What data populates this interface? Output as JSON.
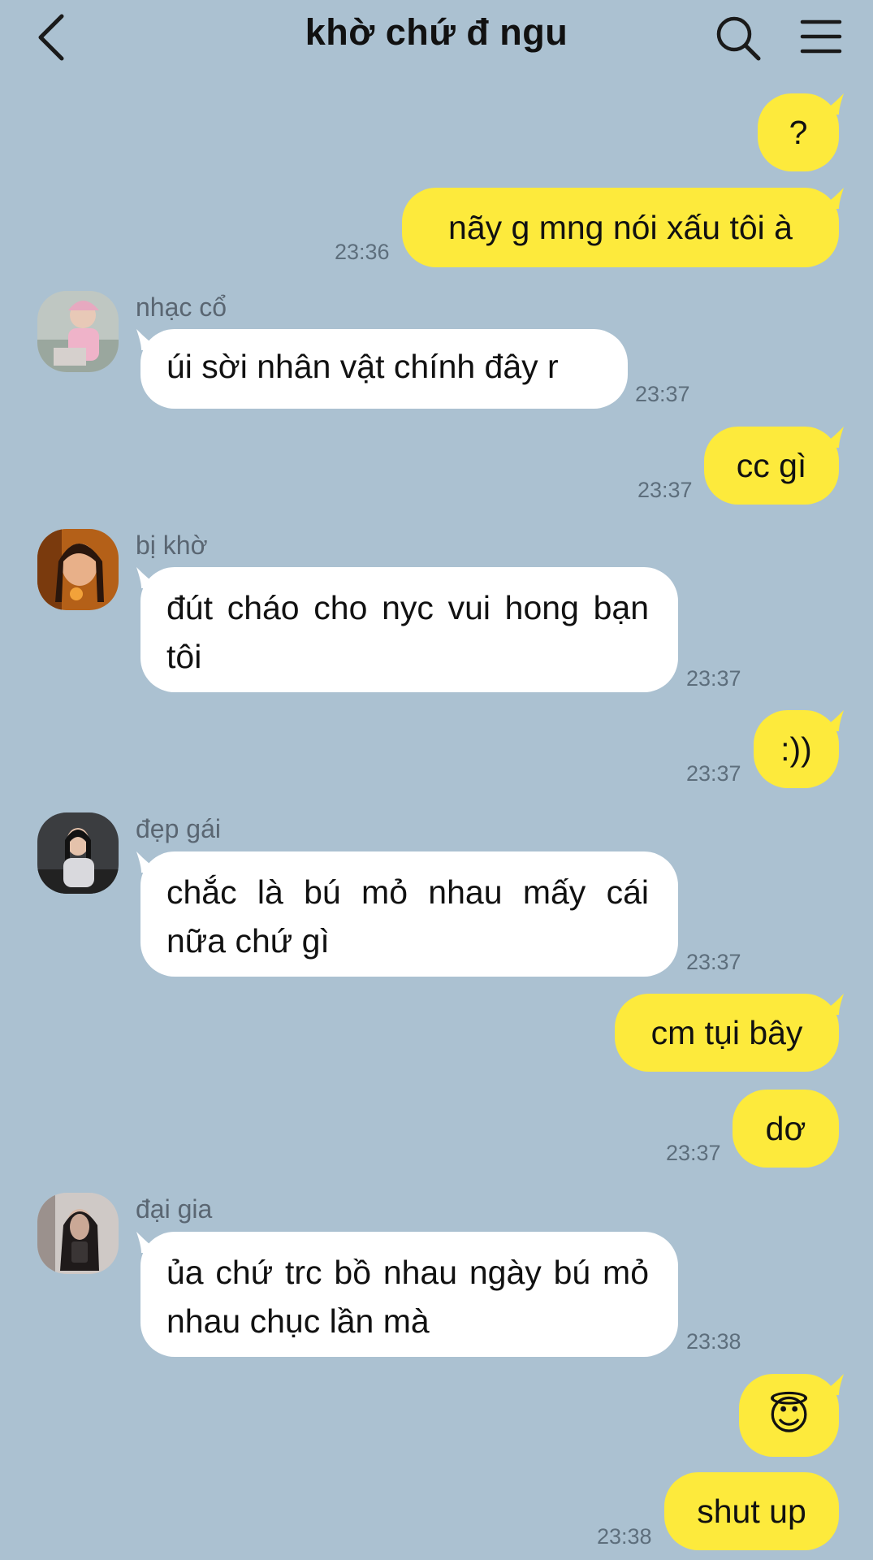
{
  "header": {
    "title": "khờ chứ đ ngu"
  },
  "colors": {
    "background": "#abc1d1",
    "outgoing_bubble": "#fdea3c",
    "incoming_bubble": "#ffffff",
    "timestamp": "#5d6e7c"
  },
  "icons": [
    "chevron-left-icon",
    "search-icon",
    "hamburger-menu-icon"
  ],
  "messages": [
    {
      "from": "me",
      "text": "?"
    },
    {
      "from": "me",
      "text": "nãy g mng nói xấu tôi à",
      "time": "23:36"
    },
    {
      "from": "nhạc cổ",
      "sender": "nhạc cổ",
      "text": "úi sời nhân vật chính đây r",
      "time": "23:37"
    },
    {
      "from": "me",
      "text": "cc gì",
      "time": "23:37"
    },
    {
      "from": "bị khờ",
      "sender": "bị khờ",
      "text": "đút cháo cho nyc vui hong bạn tôi",
      "time": "23:37"
    },
    {
      "from": "me",
      "text": ":))",
      "time": "23:37"
    },
    {
      "from": "đẹp gái",
      "sender": "đẹp gái",
      "text": "chắc là bú mỏ nhau mấy cái nữa chứ gì",
      "time": "23:37"
    },
    {
      "from": "me",
      "text": "cm tụi bây"
    },
    {
      "from": "me",
      "text": "dơ",
      "time": "23:37"
    },
    {
      "from": "đại gia",
      "sender": "đại gia",
      "text": "ủa chứ trc bồ nhau ngày bú mỏ nhau chục lần mà",
      "time": "23:38"
    },
    {
      "from": "me",
      "text": "😇"
    },
    {
      "from": "me",
      "text": "shut up",
      "time": "23:38"
    }
  ]
}
